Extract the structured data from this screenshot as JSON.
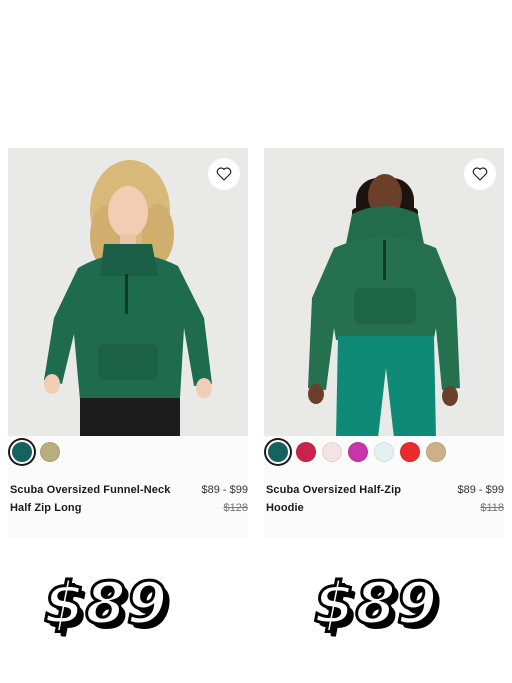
{
  "products": [
    {
      "name": "Scuba Oversized Funnel-Neck Half Zip Long",
      "price": "$89 - $99",
      "original_price": "$128",
      "swatches": [
        "#15635e",
        "#b9ad7c"
      ],
      "selected_swatch": 0,
      "wishlist_icon": "heart-icon",
      "garment_color": "#1f6b4f",
      "big_price": "$89"
    },
    {
      "name": "Scuba Oversized Half-Zip Hoodie",
      "price": "$89 - $99",
      "original_price": "$118",
      "swatches": [
        "#15635e",
        "#c8234a",
        "#f7e3e4",
        "#c935a9",
        "#e3f2ef",
        "#ea2b2b",
        "#cdb086"
      ],
      "selected_swatch": 0,
      "wishlist_icon": "heart-icon",
      "garment_color": "#24704f",
      "big_price": "$89"
    }
  ]
}
